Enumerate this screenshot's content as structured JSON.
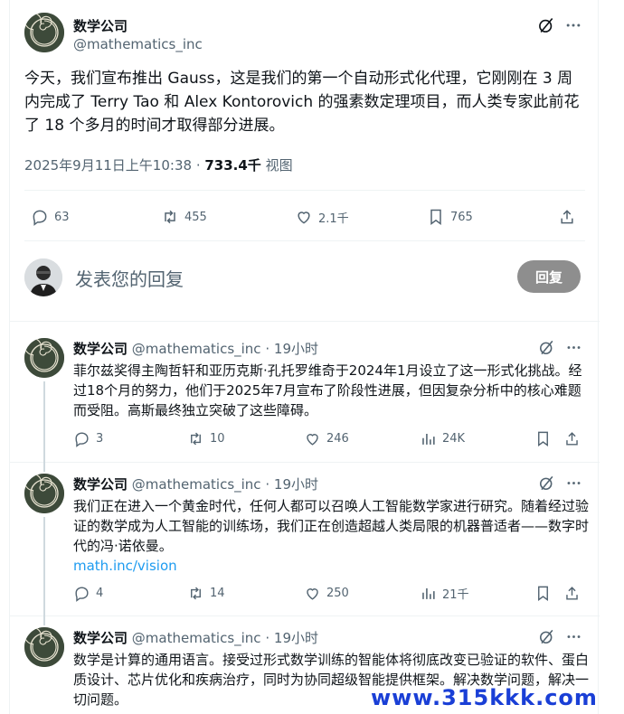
{
  "post": {
    "author_name": "数学公司",
    "handle": "@mathematics_inc",
    "text": "今天，我们宣布推出 Gauss，这是我们的第一个自动形式化代理，它刚刚在 3 周内完成了 Terry Tao 和 Alex Kontorovich 的强素数定理项目，而人类专家此前花了 18 个多月的时间才取得部分进展。",
    "timestamp": "2025年9月11日上午10:38",
    "separator": " · ",
    "views_count": "733.4千",
    "views_label": " 视图",
    "stats": {
      "replies": "63",
      "reposts": "455",
      "likes": "2.1千",
      "bookmarks": "765"
    }
  },
  "reply_box": {
    "placeholder": "发表您的回复",
    "button_label": "回复"
  },
  "replies": [
    {
      "author_name": "数学公司",
      "handle": "@mathematics_inc",
      "time": "19小时",
      "text": "菲尔兹奖得主陶哲轩和亚历克斯·孔托罗维奇于2024年1月设立了这一形式化挑战。经过18个月的努力，他们于2025年7月宣布了阶段性进展，但因复杂分析中的核心难题而受阻。高斯最终独立突破了这些障碍。",
      "link": "",
      "replies": "3",
      "reposts": "10",
      "likes": "246",
      "views": "24K"
    },
    {
      "author_name": "数学公司",
      "handle": "@mathematics_inc",
      "time": "19小时",
      "text": "我们正在进入一个黄金时代，任何人都可以召唤人工智能数学家进行研究。随着经过验证的数学成为人工智能的训练场，我们正在创造超越人类局限的机器普适者——数字时代的冯·诺依曼。",
      "link": "math.inc/vision",
      "replies": "4",
      "reposts": "14",
      "likes": "250",
      "views": "21千"
    },
    {
      "author_name": "数学公司",
      "handle": "@mathematics_inc",
      "time": "19小时",
      "text": "数学是计算的通用语言。接受过形式数学训练的智能体将彻底改变已验证的软件、蛋白质设计、芯片优化和疾病治疗，同时为协同超级智能提供框架。解决数学问题，解决一切问题。",
      "link": ""
    }
  ],
  "watermark": "www.315kkk.com",
  "colors": {
    "accent": "#1d9bf0",
    "text_primary": "#0f1419",
    "text_secondary": "#536471",
    "reply_button": "#8e8e8e",
    "avatar_bg": "#3d4a3a"
  },
  "icons": [
    "grok-icon",
    "more-icon",
    "comment-icon",
    "repost-icon",
    "heart-icon",
    "bookmark-icon",
    "share-icon",
    "views-icon",
    "nautilus-logo"
  ]
}
